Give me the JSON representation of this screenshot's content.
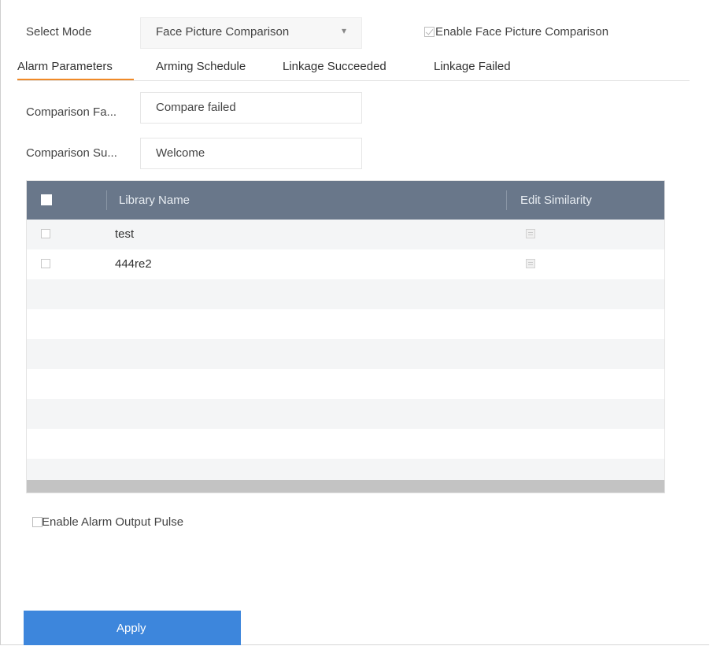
{
  "select_mode": {
    "label": "Select Mode",
    "value": "Face Picture Comparison",
    "dropdown_icon": "chevron-down-icon"
  },
  "enable_comparison": {
    "label": "Enable Face Picture Comparison",
    "checked": true
  },
  "tabs": [
    {
      "label": "Alarm Parameters",
      "active": true
    },
    {
      "label": "Arming Schedule",
      "active": false
    },
    {
      "label": "Linkage Succeeded",
      "active": false
    },
    {
      "label": "Linkage Failed",
      "active": false
    }
  ],
  "fields": {
    "comparison_failed": {
      "label": "Comparison Fa...",
      "value": "Compare failed"
    },
    "comparison_succeeded": {
      "label": "Comparison Su...",
      "value": "Welcome"
    }
  },
  "table": {
    "columns": {
      "name": "Library Name",
      "edit": "Edit Similarity"
    },
    "rows": [
      {
        "name": "test"
      },
      {
        "name": "444re2"
      }
    ]
  },
  "alarm_output_pulse": {
    "label": "Enable Alarm Output Pulse",
    "checked": false
  },
  "apply_label": "Apply",
  "colors": {
    "accent_tab": "#f08a28",
    "table_header": "#69778a",
    "apply_button": "#3d86dc"
  }
}
